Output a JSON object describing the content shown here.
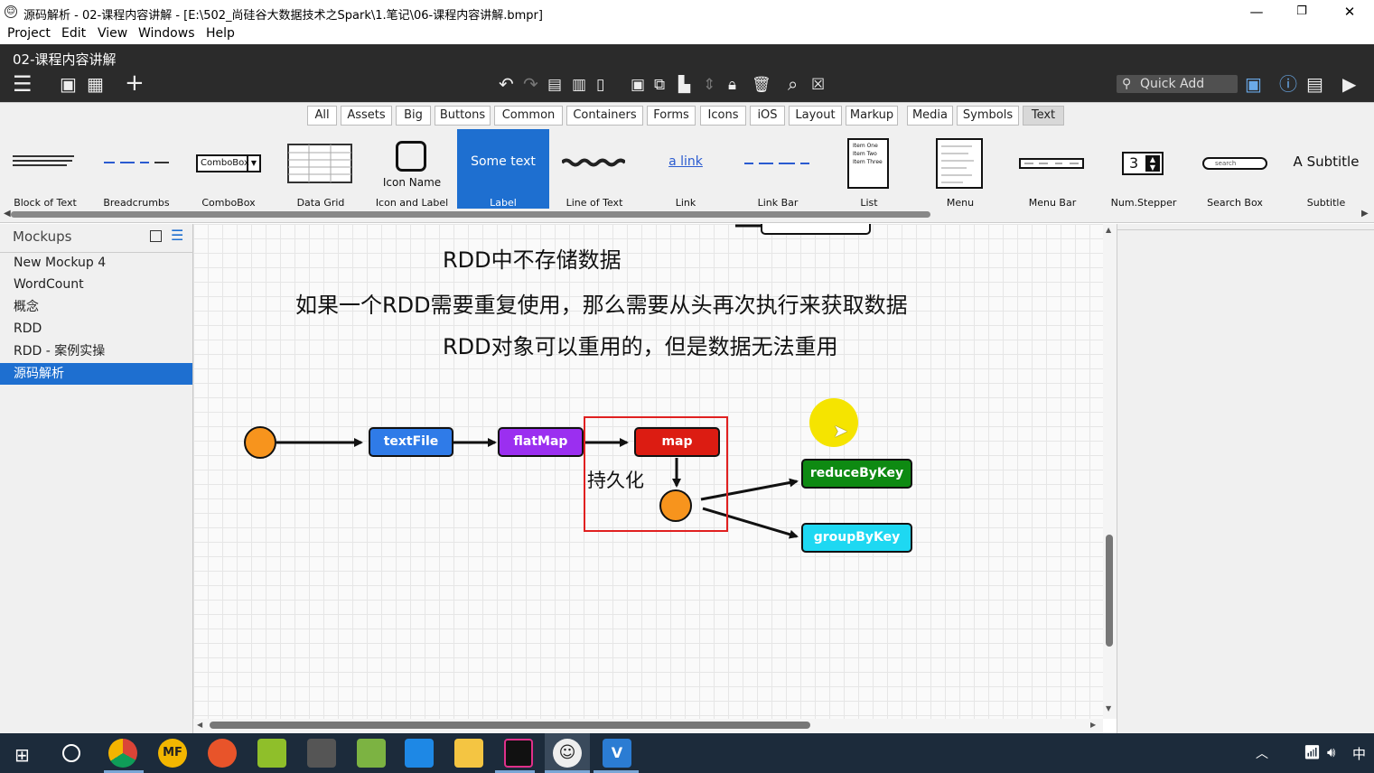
{
  "window": {
    "title": "源码解析 - 02-课程内容讲解 - [E:\\502_尚硅谷大数据技术之Spark\\1.笔记\\06-课程内容讲解.bmpr]",
    "minimize": "—",
    "maximize": "❐",
    "close": "✕"
  },
  "menu": [
    "Project",
    "Edit",
    "View",
    "Windows",
    "Help"
  ],
  "document_title": "02-课程内容讲解",
  "quick_add_placeholder": "Quick Add",
  "filter_tabs": [
    "All",
    "Assets",
    "Big",
    "Buttons",
    "Common",
    "Containers",
    "Forms",
    "Icons",
    "iOS",
    "Layout",
    "Markup",
    "Media",
    "Symbols",
    "Text"
  ],
  "active_filter": "Text",
  "library": {
    "items": [
      {
        "label": "Block of Text",
        "icon": "block-of-text"
      },
      {
        "label": "Breadcrumbs",
        "icon": "breadcrumbs"
      },
      {
        "label": "ComboBox",
        "icon": "combobox",
        "preview": "ComboBox"
      },
      {
        "label": "Data Grid",
        "icon": "data-grid"
      },
      {
        "label": "Icon and Label",
        "icon": "icon-and-label",
        "preview": "Icon Name"
      },
      {
        "label": "Label",
        "icon": "label",
        "preview": "Some text",
        "selected": true
      },
      {
        "label": "Line of Text",
        "icon": "line-of-text"
      },
      {
        "label": "Link",
        "icon": "link",
        "preview": "a link"
      },
      {
        "label": "Link Bar",
        "icon": "link-bar"
      },
      {
        "label": "List",
        "icon": "list",
        "preview_items": [
          "Item One",
          "Item Two",
          "Item Three"
        ]
      },
      {
        "label": "Menu",
        "icon": "menu"
      },
      {
        "label": "Menu Bar",
        "icon": "menu-bar"
      },
      {
        "label": "Num.Stepper",
        "icon": "num-stepper",
        "preview": "3"
      },
      {
        "label": "Search Box",
        "icon": "search-box",
        "preview": "search"
      },
      {
        "label": "Subtitle",
        "icon": "subtitle",
        "preview": "A Subtitle"
      }
    ]
  },
  "sidebar": {
    "header": "Mockups",
    "items": [
      {
        "label": "New Mockup 4"
      },
      {
        "label": "WordCount"
      },
      {
        "label": "概念"
      },
      {
        "label": "RDD"
      },
      {
        "label": "RDD - 案例实操"
      },
      {
        "label": "源码解析",
        "selected": true
      }
    ]
  },
  "canvas": {
    "lines": [
      "RDD中不存储数据",
      "如果一个RDD需要重复使用，那么需要从头再次执行来获取数据",
      "RDD对象可以重用的，但是数据无法重用"
    ],
    "nodes": [
      {
        "label": "textFile",
        "color": "#2f7be8"
      },
      {
        "label": "flatMap",
        "color": "#9b2ff0"
      },
      {
        "label": "map",
        "color": "#dc1c12"
      },
      {
        "label": "reduceByKey",
        "color": "#0e8a12"
      },
      {
        "label": "groupByKey",
        "color": "#1ed8f2"
      }
    ],
    "persist_label": "持久化"
  },
  "colors": {
    "dark_toolbar": "#2b2b2b",
    "selection_blue": "#1e6fd0",
    "highlight_box": "#e02020",
    "circle": "#f7941d",
    "cursor_highlight": "#f5e400",
    "taskbar": "#1c2b3b"
  },
  "taskbar": {
    "tray_ime": "中",
    "apps": [
      "windows-start-icon",
      "cortana-icon",
      "chrome-icon",
      "mf-icon",
      "swirl-icon",
      "app-green-icon",
      "app-tool-icon",
      "notepad-icon",
      "app-window-icon",
      "folder-icon",
      "intellij-icon",
      "balsamiq-icon",
      "visio-icon"
    ]
  }
}
